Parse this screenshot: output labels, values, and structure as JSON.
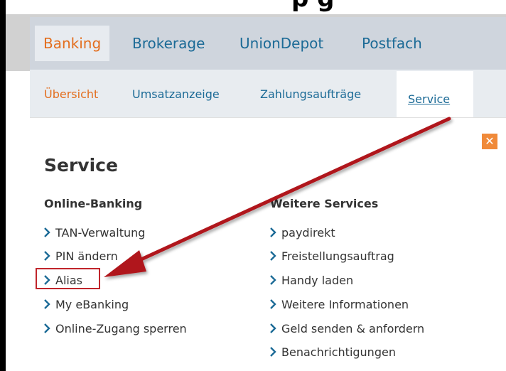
{
  "top_cut_text": "p                   g",
  "main_tabs": [
    {
      "label": "Banking"
    },
    {
      "label": "Brokerage"
    },
    {
      "label": "UnionDepot"
    },
    {
      "label": "Postfach"
    }
  ],
  "sub_tabs": [
    {
      "label": "Übersicht"
    },
    {
      "label": "Umsatzanzeige"
    },
    {
      "label": "Zahlungsaufträge"
    },
    {
      "label": "Service"
    }
  ],
  "panel": {
    "title": "Service",
    "close_label": "✕",
    "online_banking": {
      "heading": "Online-Banking",
      "items": [
        "TAN-Verwaltung",
        "PIN ändern",
        "Alias",
        "My eBanking",
        "Online-Zugang sperren"
      ]
    },
    "weitere_services": {
      "heading": "Weitere Services",
      "items": [
        "paydirekt",
        "Freistellungsauftrag",
        "Handy laden",
        "Weitere Informationen",
        "Geld senden & anfordern",
        "Benachrichtigungen"
      ]
    },
    "bottom_cut_text": "                  "
  },
  "colors": {
    "accent_orange": "#e36e1e",
    "link_blue": "#1b6a96",
    "arrow_red": "#b0141b",
    "highlight_red": "#c0252b"
  },
  "icons": {
    "chevron": "chevron-right-icon",
    "close": "close-icon"
  }
}
